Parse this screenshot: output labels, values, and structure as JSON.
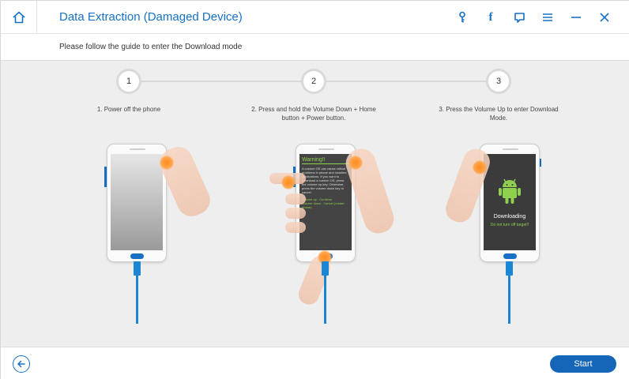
{
  "window": {
    "title": "Data Extraction (Damaged Device)",
    "icons": [
      "home-icon",
      "key-icon",
      "facebook-icon",
      "feedback-icon",
      "menu-icon",
      "minimize-icon",
      "close-icon"
    ],
    "facebook_glyph": "f"
  },
  "guide": {
    "instruction": "Please follow the guide to enter the Download mode",
    "steps": [
      {
        "number": "1",
        "text": "1. Power off the phone"
      },
      {
        "number": "2",
        "text": "2. Press and hold the Volume Down + Home button + Power button."
      },
      {
        "number": "3",
        "text": "3. Press the Volume Up to enter Download Mode."
      }
    ]
  },
  "phone2": {
    "warning_title": "Warning!!",
    "warning_body": "A custom OS can cause critical problems in phone and installed applications. If you want to download a custom OS, press the volume up key. Otherwise, press the volume down key to cancel.",
    "volume_up": "Volume up : Continue",
    "volume_down": "Volume down : Cancel (restart phone)"
  },
  "phone3": {
    "downloading": "Downloading",
    "warning": "Do not turn off target!!"
  },
  "footer": {
    "start_label": "Start"
  },
  "colors": {
    "accent": "#1670c5",
    "cable": "#1b86d3",
    "android_green": "#8fd14f",
    "touch_orange": "#ff8a1e"
  }
}
